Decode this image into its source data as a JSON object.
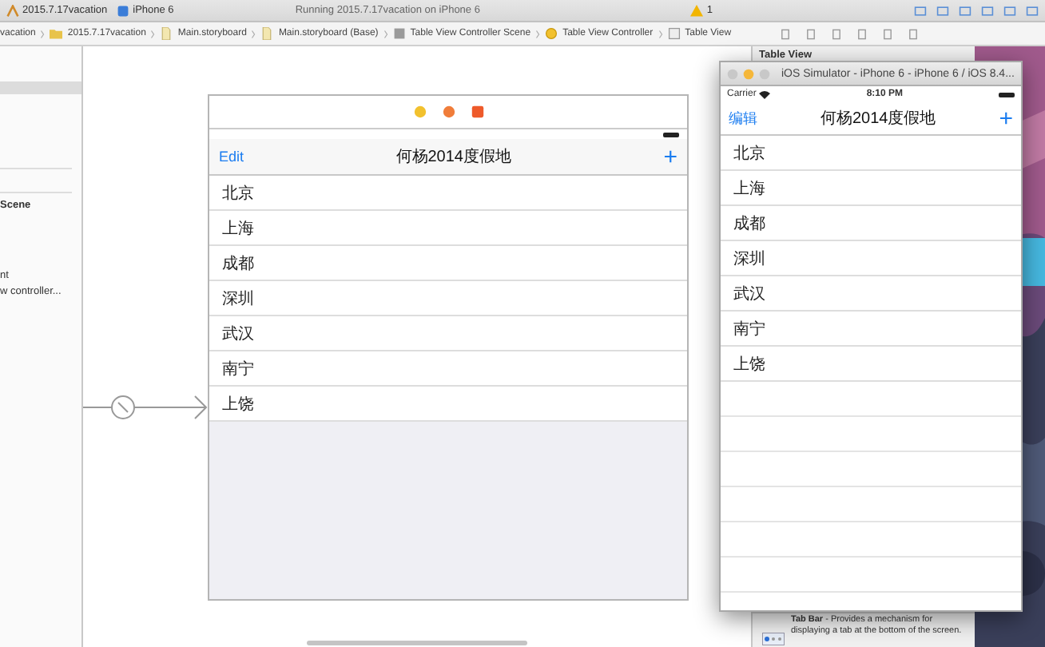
{
  "toolbar": {
    "scheme": "2015.7.17vacation",
    "device": "iPhone 6",
    "status": "Running 2015.7.17vacation on iPhone 6",
    "warnings": "1"
  },
  "jump_bar": {
    "crumbs": [
      {
        "label": "vacation"
      },
      {
        "label": "2015.7.17vacation",
        "kind": "folder"
      },
      {
        "label": "Main.storyboard",
        "kind": "file"
      },
      {
        "label": "Main.storyboard (Base)",
        "kind": "file"
      },
      {
        "label": "Table View Controller Scene",
        "kind": "scene"
      },
      {
        "label": "Table View Controller",
        "kind": "controller"
      },
      {
        "label": "Table View",
        "kind": "view"
      }
    ]
  },
  "outline": {
    "items": [
      {
        "label": "Scene",
        "kind": "header"
      },
      {
        "label": "nt",
        "kind": "item"
      },
      {
        "label": "w controller...",
        "kind": "item"
      }
    ]
  },
  "storyboard_scene": {
    "nav": {
      "left": "Edit",
      "title": "何杨2014度假地",
      "right": "+"
    },
    "rows": [
      "北京",
      "上海",
      "成都",
      "深圳",
      "武汉",
      "南宁",
      "上饶"
    ]
  },
  "inspector": {
    "title": "Table View",
    "library_item": "**Tab Bar** - Provides a mechanism for displaying a tab at the bottom of the screen."
  },
  "simulator": {
    "title": "iOS Simulator - iPhone 6 - iPhone 6 / iOS 8.4...",
    "carrier": "Carrier",
    "time": "8:10 PM",
    "nav": {
      "left": "编辑",
      "title": "何杨2014度假地",
      "right": "+"
    },
    "rows": [
      "北京",
      "上海",
      "成都",
      "深圳",
      "武汉",
      "南宁",
      "上饶"
    ]
  }
}
